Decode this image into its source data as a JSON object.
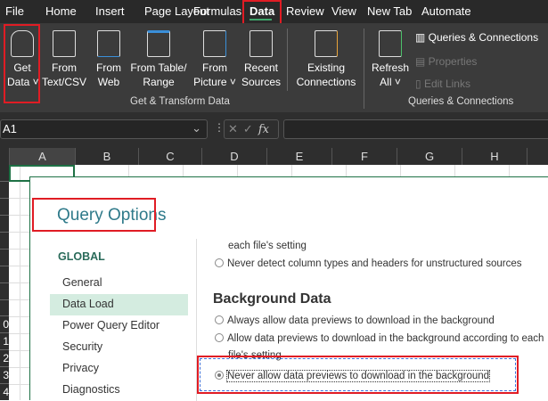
{
  "ribbon_tabs": [
    "File",
    "Home",
    "Insert",
    "Page Layout",
    "Formulas",
    "Data",
    "Review",
    "View",
    "New Tab",
    "Automate"
  ],
  "active_tab": "Data",
  "ribbon": {
    "get_data": [
      "Get",
      "Data ˅"
    ],
    "from_text": [
      "From",
      "Text/CSV"
    ],
    "from_web": [
      "From",
      "Web"
    ],
    "from_table": [
      "From Table/",
      "Range"
    ],
    "from_picture": [
      "From",
      "Picture ˅"
    ],
    "recent_sources": [
      "Recent",
      "Sources"
    ],
    "existing_connections": [
      "Existing",
      "Connections"
    ],
    "group1": "Get & Transform Data",
    "refresh_all": [
      "Refresh",
      "All ˅"
    ],
    "queries_connections": "Queries & Connections",
    "properties": "Properties",
    "edit_links": "Edit Links",
    "group2": "Queries & Connections"
  },
  "formula_bar": {
    "name_box": "A1",
    "fx": "fx",
    "cancel": "✕",
    "enter": "✓"
  },
  "columns": [
    "A",
    "B",
    "C",
    "D",
    "E",
    "F",
    "G",
    "H"
  ],
  "rows": [
    "",
    "",
    "",
    "",
    "",
    "",
    "",
    "",
    "",
    "0",
    "1",
    "2",
    "3",
    "4"
  ],
  "dialog": {
    "title": "Query Options",
    "section": "GLOBAL",
    "nav": [
      "General",
      "Data Load",
      "Power Query Editor",
      "Security",
      "Privacy",
      "Diagnostics"
    ],
    "selected_nav": "Data Load",
    "content": {
      "cont_text": "each file's setting",
      "never_detect": "Never detect column types and headers for unstructured sources",
      "bg_heading": "Background Data",
      "always_allow": "Always allow data previews to download in the background",
      "allow_per_file": "Allow data previews to download in the background according to each",
      "allow_per_file_2": "file's setting",
      "never_allow": "Never allow data previews to download in the background"
    }
  },
  "colors": {
    "highlight": "#e01c24",
    "accent": "#1e7145",
    "nav_selected": "#d4ece0"
  }
}
